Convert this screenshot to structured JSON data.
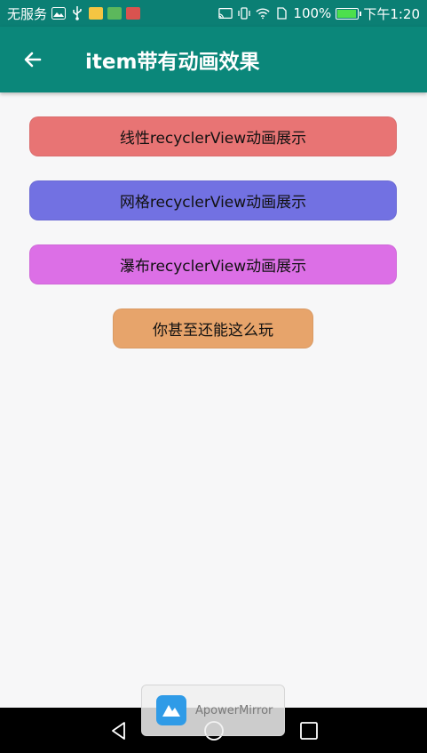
{
  "status_bar": {
    "carrier": "无服务",
    "battery_percent": "100%",
    "battery_level": 1.0,
    "time": "下午1:20",
    "icons": [
      "gallery-icon",
      "usb-icon",
      "weibo-icon",
      "maps-icon",
      "news-icon",
      "cast-icon",
      "vibrate-icon",
      "wifi-icon",
      "sim-icon",
      "battery-icon"
    ]
  },
  "app_bar": {
    "title": "item带有动画效果",
    "background": "#0b877a",
    "back_icon": "arrow-left-icon"
  },
  "buttons": {
    "linear": {
      "label": "线性recyclerView动画展示",
      "color": "#e87474"
    },
    "grid": {
      "label": "网格recyclerView动画展示",
      "color": "#7271e2"
    },
    "staggered": {
      "label": "瀑布recyclerView动画展示",
      "color": "#dc6fe6"
    },
    "fun": {
      "label": "你甚至还能这么玩",
      "color": "#e7a46b"
    }
  },
  "overlay": {
    "app_name": "ApowerMirror"
  },
  "nav_bar": {
    "buttons": [
      "back-triangle-icon",
      "home-circle-icon",
      "recents-square-icon"
    ]
  }
}
